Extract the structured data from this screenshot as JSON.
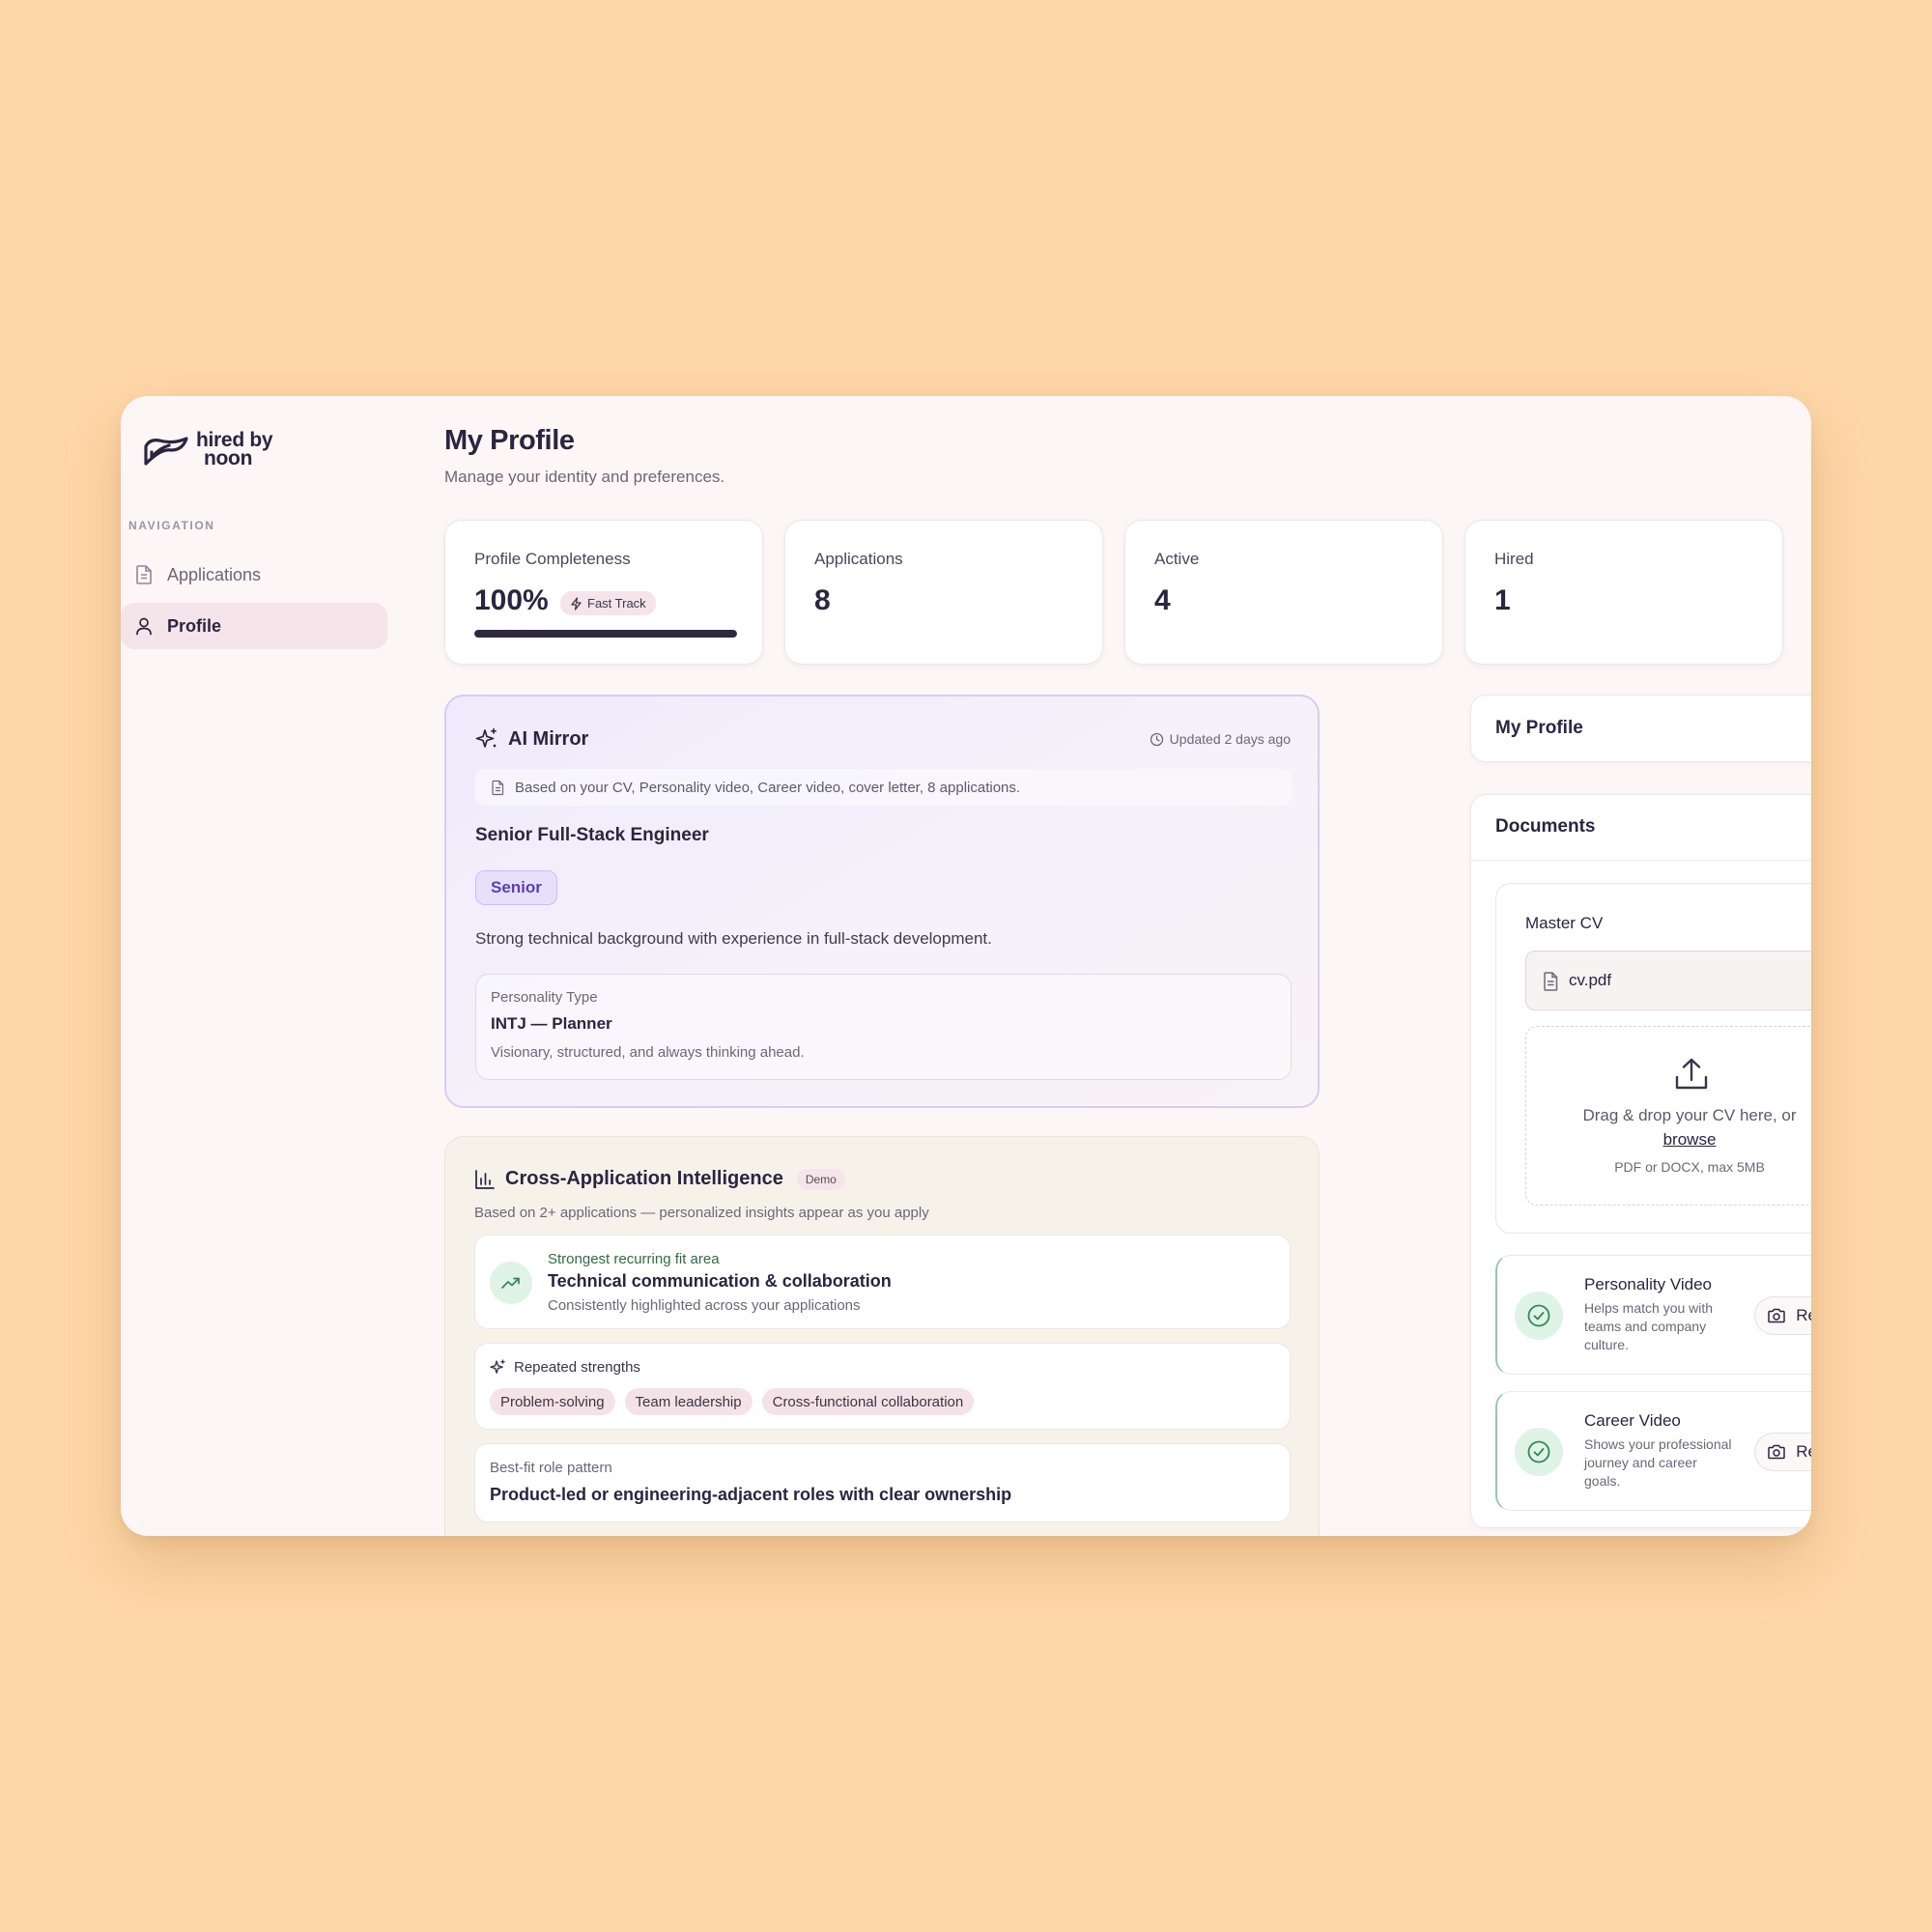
{
  "app": {
    "logo_line1": "hired by",
    "logo_line2": "noon"
  },
  "sidebar": {
    "heading": "NAVIGATION",
    "items": [
      {
        "label": "Applications",
        "icon": "file-icon",
        "active": false
      },
      {
        "label": "Profile",
        "icon": "user-icon",
        "active": true
      }
    ]
  },
  "header": {
    "title": "My Profile",
    "subtitle": "Manage your identity and preferences."
  },
  "stats": {
    "completeness": {
      "label": "Profile Completeness",
      "value": "100%",
      "badge": "Fast Track",
      "progress": 1.0
    },
    "applications": {
      "label": "Applications",
      "value": "8"
    },
    "active": {
      "label": "Active",
      "value": "4"
    },
    "hired": {
      "label": "Hired",
      "value": "1"
    }
  },
  "ai_mirror": {
    "title": "AI Mirror",
    "updated": "Updated 2 days ago",
    "based_on": "Based on your CV, Personality video, Career video, cover letter, 8 applications.",
    "role": "Senior Full-Stack Engineer",
    "level": "Senior",
    "summary": "Strong technical background with experience in full-stack development.",
    "personality": {
      "label": "Personality Type",
      "value": "INTJ — Planner",
      "description": "Visionary, structured, and always thinking ahead."
    }
  },
  "cross_app": {
    "title": "Cross-Application Intelligence",
    "badge": "Demo",
    "subtitle": "Based on 2+ applications — personalized insights appear as you apply",
    "fit": {
      "label": "Strongest recurring fit area",
      "title": "Technical communication & collaboration",
      "description": "Consistently highlighted across your applications"
    },
    "strengths": {
      "title": "Repeated strengths",
      "tags": [
        "Problem-solving",
        "Team leadership",
        "Cross-functional collaboration"
      ]
    },
    "pattern": {
      "label": "Best-fit role pattern",
      "value": "Product-led or engineering-adjacent roles with clear ownership"
    }
  },
  "right": {
    "my_profile": {
      "title": "My Profile"
    },
    "documents": {
      "title": "Documents",
      "master_cv": {
        "title": "Master CV",
        "file_name": "cv.pdf",
        "drop_text": "Drag & drop your CV here, or",
        "browse": "browse",
        "hint": "PDF or DOCX, max 5MB"
      },
      "videos": [
        {
          "title": "Personality Video",
          "description": "Helps match you with teams and company culture.",
          "button": "Record"
        },
        {
          "title": "Career Video",
          "description": "Shows your professional journey and career goals.",
          "button": "Record"
        }
      ]
    }
  },
  "colors": {
    "background": "#fed7a8",
    "accent_dark": "#2e2845",
    "ai_border": "#d6cdf1",
    "success": "#2f8a55"
  }
}
